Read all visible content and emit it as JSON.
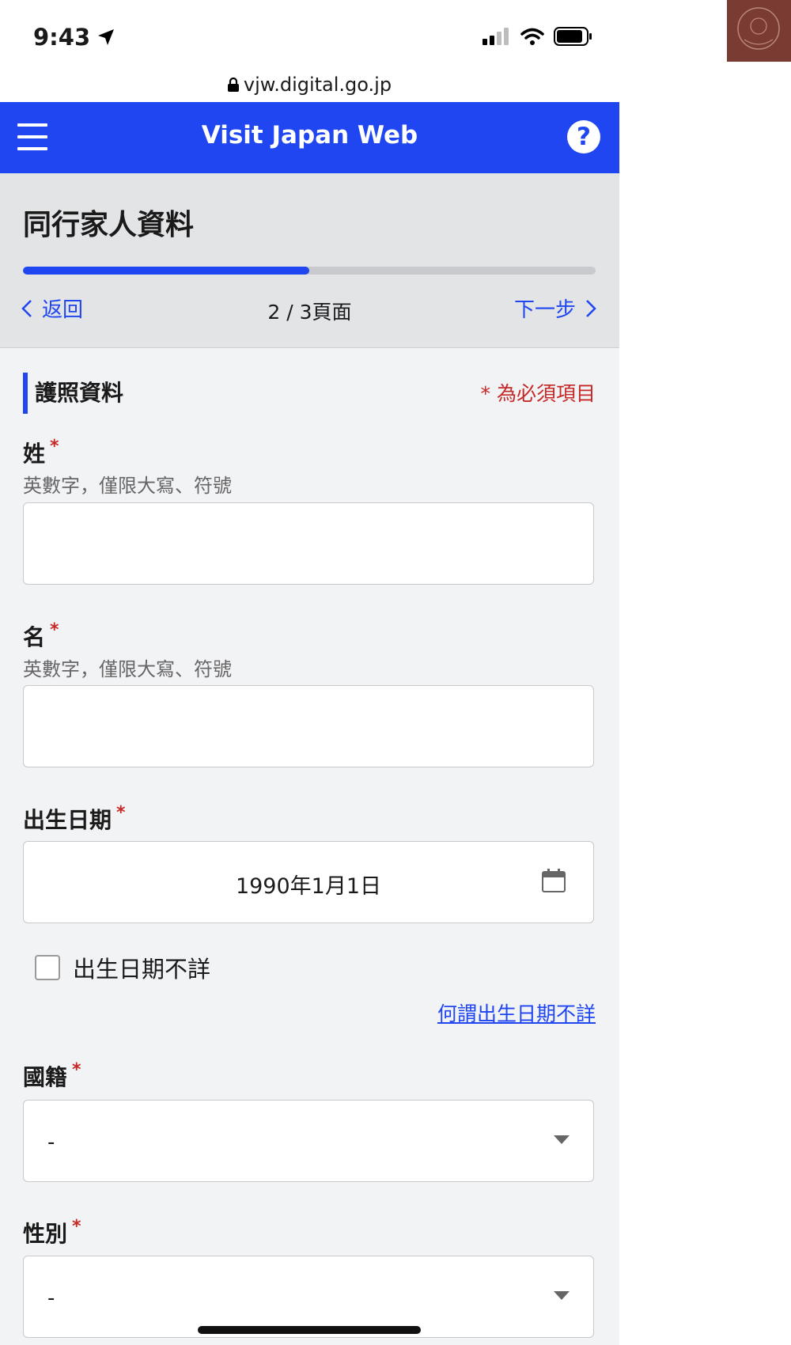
{
  "status_bar": {
    "time": "9:43"
  },
  "browser": {
    "url": "vjw.digital.go.jp"
  },
  "app_bar": {
    "title": "Visit Japan Web",
    "help_label": "?"
  },
  "page": {
    "title": "同行家人資料",
    "progress_fraction": 0.5,
    "back_label": "返回",
    "page_indicator": "2 / 3頁面",
    "next_label": "下一步"
  },
  "section": {
    "title": "護照資料",
    "required_note": "* 為必須項目"
  },
  "fields": {
    "surname": {
      "label": "姓",
      "hint": "英數字，僅限大寫、符號",
      "value": ""
    },
    "given_name": {
      "label": "名",
      "hint": "英數字，僅限大寫、符號",
      "value": ""
    },
    "birth_date": {
      "label": "出生日期",
      "value": "1990年1月1日",
      "unknown_label": "出生日期不詳",
      "help_link": "何謂出生日期不詳"
    },
    "nationality": {
      "label": "國籍",
      "value": "-"
    },
    "gender": {
      "label": "性別",
      "value": "-"
    }
  },
  "required_mark": "*",
  "colors": {
    "brand": "#1f46f0",
    "required": "#c62828"
  }
}
